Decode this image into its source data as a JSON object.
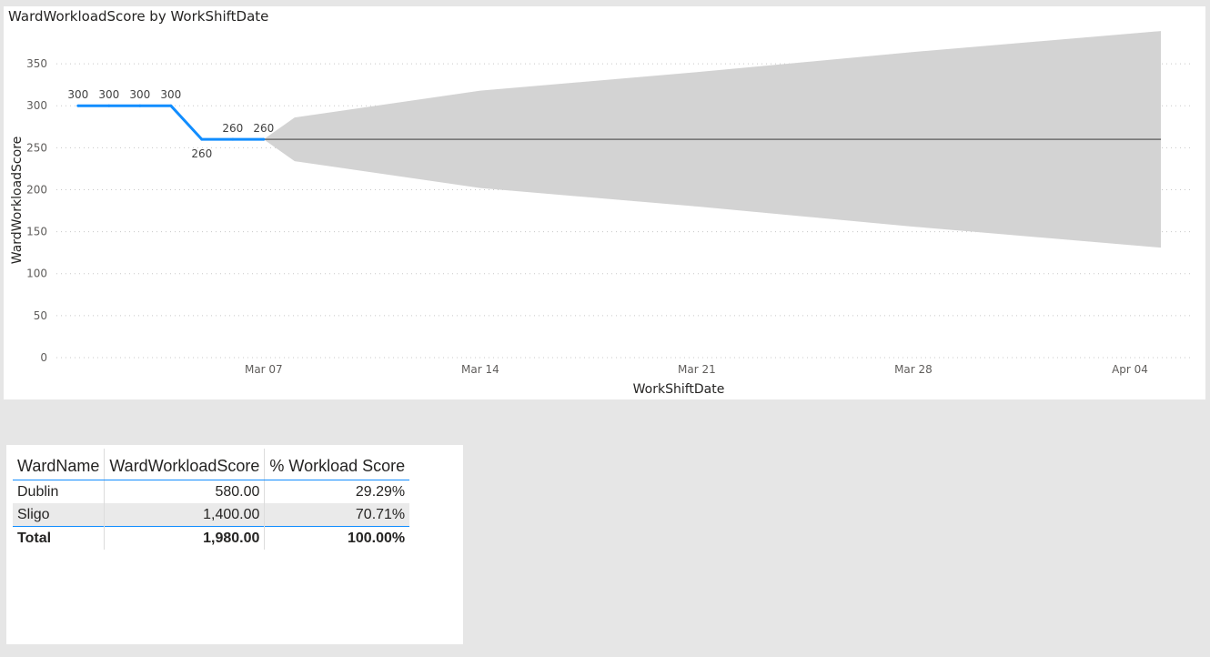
{
  "chart": {
    "title": "WardWorkloadScore by WorkShiftDate"
  },
  "chart_data": {
    "type": "line",
    "title": "WardWorkloadScore by WorkShiftDate",
    "xlabel": "WorkShiftDate",
    "ylabel": "WardWorkloadScore",
    "ylim": [
      0,
      375
    ],
    "y_ticks": [
      0,
      50,
      100,
      150,
      200,
      250,
      300,
      350
    ],
    "x_ticks": [
      "Mar 07",
      "Mar 14",
      "Mar 21",
      "Mar 28",
      "Apr 04"
    ],
    "grid": true,
    "series": [
      {
        "color": "#118dff",
        "x": [
          "2021-03-01",
          "2021-03-02",
          "2021-03-03",
          "2021-03-04",
          "2021-03-05",
          "2021-03-06",
          "2021-03-07"
        ],
        "y": [
          300,
          300,
          300,
          300,
          260,
          260,
          260
        ],
        "data_labels": [
          "300",
          "300",
          "300",
          "300",
          "260",
          "260",
          "260"
        ]
      }
    ],
    "forecast": {
      "color": "#6e6e6e",
      "band_color": "#d3d3d3",
      "x": [
        "2021-03-07",
        "2021-03-08",
        "2021-03-14",
        "2021-03-21",
        "2021-03-28",
        "2021-04-05"
      ],
      "y": [
        260,
        260,
        260,
        260,
        260,
        260
      ],
      "upper": [
        260,
        286,
        318,
        340,
        364,
        389
      ],
      "lower": [
        260,
        234,
        202,
        180,
        156,
        131
      ]
    }
  },
  "table": {
    "columns": [
      "WardName",
      "WardWorkloadScore",
      "% Workload Score"
    ],
    "rows": [
      {
        "name": "Dublin",
        "score": "580.00",
        "pct": "29.29%"
      },
      {
        "name": "Sligo",
        "score": "1,400.00",
        "pct": "70.71%"
      }
    ],
    "total": {
      "name": "Total",
      "score": "1,980.00",
      "pct": "100.00%"
    }
  }
}
